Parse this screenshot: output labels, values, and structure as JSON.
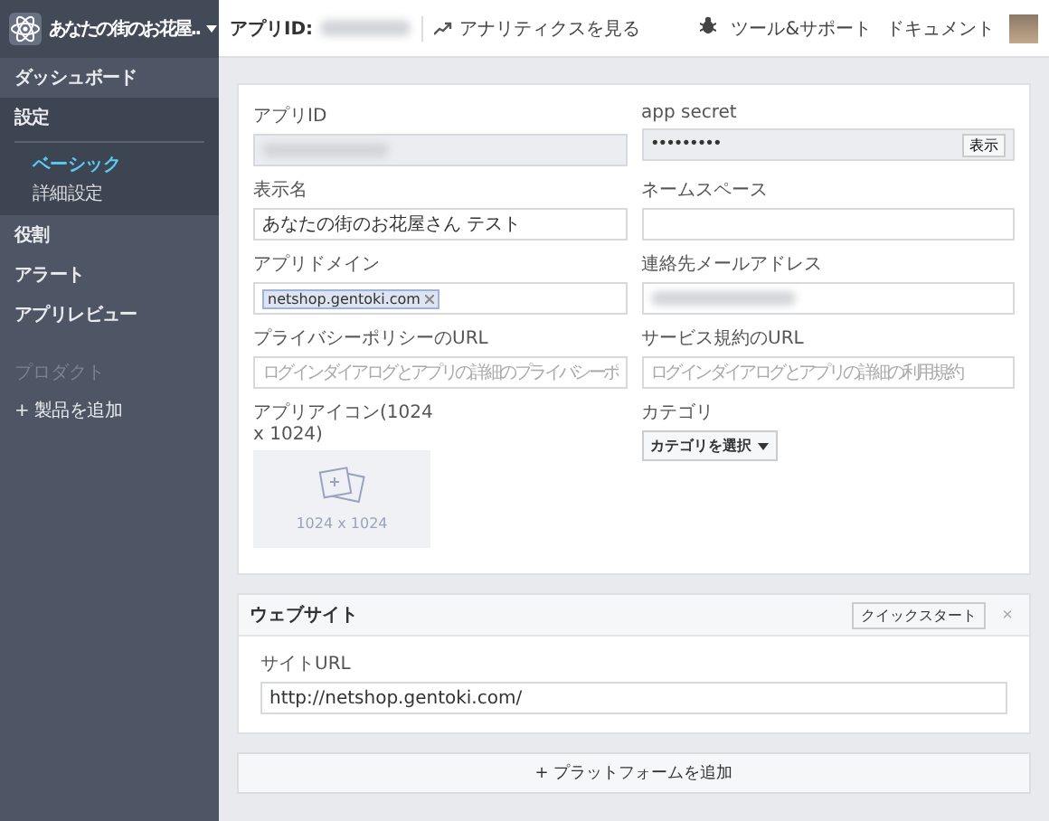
{
  "sidebar": {
    "app_name": "あなたの街のお花屋..",
    "items": [
      {
        "kind": "link",
        "label": "ダッシュボード",
        "expanded": false
      },
      {
        "kind": "link",
        "label": "設定",
        "expanded": true,
        "children": [
          {
            "label": "ベーシック",
            "selected": true
          },
          {
            "label": "詳細設定",
            "selected": false
          }
        ]
      },
      {
        "kind": "link",
        "label": "役割",
        "expanded": false
      },
      {
        "kind": "link",
        "label": "アラート",
        "expanded": false
      },
      {
        "kind": "link",
        "label": "アプリレビュー",
        "expanded": false
      },
      {
        "kind": "heading",
        "label": "プロダクト"
      },
      {
        "kind": "action",
        "label": "+ 製品を追加"
      }
    ]
  },
  "header": {
    "app_id_label": "アプリID:",
    "analytics_link": "アナリティクスを見る",
    "tools_link": "ツール&サポート",
    "docs_link": "ドキュメント"
  },
  "settings_form": {
    "fields": [
      {
        "kind": "blurred",
        "label": "アプリID"
      },
      {
        "kind": "password",
        "label": "app secret",
        "value": "•••••••••",
        "button": "表示"
      },
      {
        "kind": "text",
        "label": "表示名",
        "value": "あなたの街のお花屋さん テスト"
      },
      {
        "kind": "text",
        "label": "ネームスペース"
      },
      {
        "kind": "tags",
        "label": "アプリドメイン",
        "tags": [
          "netshop.gentoki.com"
        ]
      },
      {
        "kind": "blurred-input",
        "label": "連絡先メールアドレス"
      },
      {
        "kind": "text",
        "label": "プライバシーポリシーのURL",
        "placeholder": "ログインダイアログとアプリの詳細のプライバシーポ"
      },
      {
        "kind": "text",
        "label": "サービス規約のURL",
        "placeholder": "ログインダイアログとアプリの詳細の利用規約"
      },
      {
        "kind": "image",
        "label": "アプリアイコン(1024 x 1024)",
        "caption": "1024 x 1024"
      },
      {
        "kind": "dropdown",
        "label": "カテゴリ",
        "button": "カテゴリを選択"
      }
    ]
  },
  "website": {
    "title": "ウェブサイト",
    "quick_start": "クイックスタート",
    "close": "×",
    "field_label": "サイトURL",
    "field_value": "http://netshop.gentoki.com/"
  },
  "add_platform": "+ プラットフォームを追加"
}
